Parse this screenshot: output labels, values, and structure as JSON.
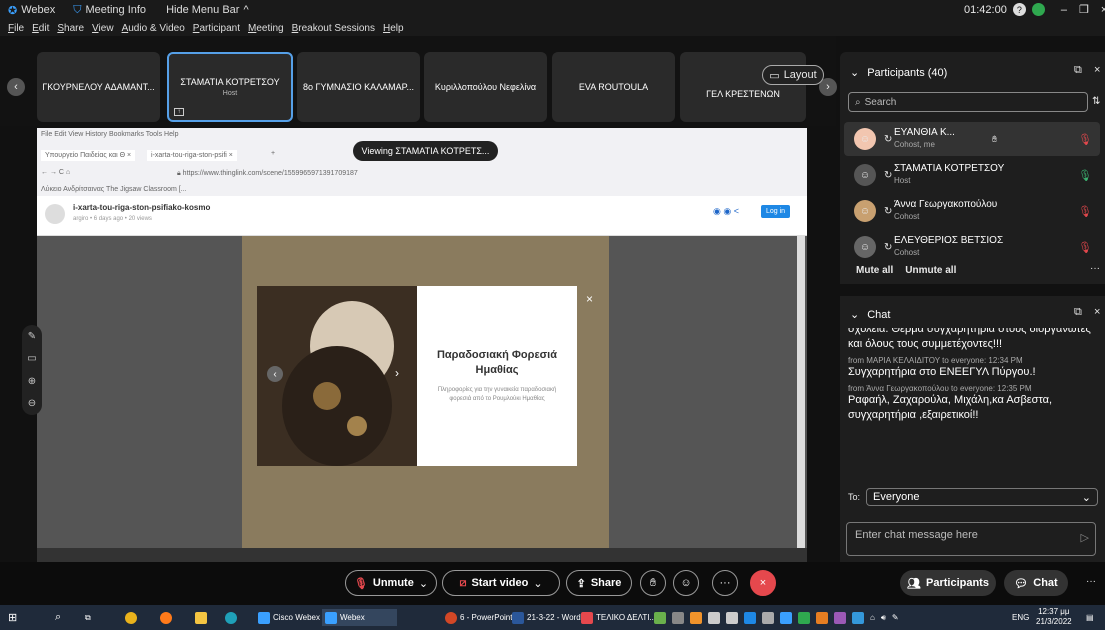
{
  "titlebar": {
    "app": "Webex",
    "meeting_info": "Meeting Info",
    "hide_menu": "Hide Menu Bar",
    "time": "01:42:00"
  },
  "menu": [
    "File",
    "Edit",
    "Share",
    "View",
    "Audio & Video",
    "Participant",
    "Meeting",
    "Breakout Sessions",
    "Help"
  ],
  "filmstrip": {
    "tiles": [
      {
        "name": "ΓΚΟΥΡΝΕΛΟΥ ΑΔΑΜΑΝΤ...",
        "sub": ""
      },
      {
        "name": "ΣΤΑΜΑΤΙΑ ΚΟΤΡΕΤΣΟΥ",
        "sub": "Host"
      },
      {
        "name": "8ο ΓΥΜΝΑΣΙΟ ΚΑΛΑΜΑΡ...",
        "sub": ""
      },
      {
        "name": "Κυριλλοπούλου Νεφελίνα",
        "sub": ""
      },
      {
        "name": "EVA ROUTOULA",
        "sub": ""
      },
      {
        "name": "ΓΕΛ ΚΡΕΣΤΕΝΩΝ",
        "sub": ""
      }
    ],
    "layout_label": "Layout"
  },
  "share": {
    "viewing": "Viewing ΣΤΑΜΑΤΙΑ ΚΟΤΡΕΤΣ...",
    "browser_menu": "File  Edit  View  History  Bookmarks  Tools  Help",
    "tab1": "Υπουργείο Παιδείας και Θ ×",
    "tab2": "i-xarta-tou-riga-ston-psifi ×",
    "url": "https://www.thinglink.com/scene/1559965971391709187",
    "bookmarks": "Λύκειο Ανδρίτσαινας   The Jigsaw Classroom [...",
    "page_title": "i-xarta-tou-riga-ston-psifiako-kosmo",
    "page_author": "argiro  •  6 days ago  •  20 views",
    "login": "Log in",
    "card_title": "Παραδοσιακή Φορεσιά Ημαθίας",
    "card_desc": "Πληροφορίες για την γυναικεία παραδοσιακή φορεσιά από το Ρουμλούκι Ημαθίας"
  },
  "participants": {
    "header": "Participants (40)",
    "search_placeholder": "Search",
    "list": [
      {
        "name": "ΕΥΑΝΘΙΑ Κ...",
        "role": "Cohost, me"
      },
      {
        "name": "ΣΤΑΜΑΤΙΑ ΚΟΤΡΕΤΣΟΥ",
        "role": "Host"
      },
      {
        "name": "Άννα Γεωργακοπούλου",
        "role": "Cohost"
      },
      {
        "name": "ΕΛΕΥΘΕΡΙΟΣ ΒΕΤΣΙΟΣ",
        "role": "Cohost"
      }
    ],
    "mute_all": "Mute all",
    "unmute_all": "Unmute all"
  },
  "chat": {
    "header": "Chat",
    "messages": [
      {
        "meta": "",
        "text": "σχολεία. Θερμά συγχαρητήρια στους διοργανωτές και όλους τους συμμετέχοντες!!!"
      },
      {
        "meta": "from ΜΑΡΙΑ ΚΕΛΑΙΔΙΤΟΥ to everyone:   12:34 PM",
        "text": "Συγχαρητήρια στο ΕΝΕΕΓΥΛ Πύργου.!"
      },
      {
        "meta": "from Άννα Γεωργακοπούλου to everyone:   12:35 PM",
        "text": "Ραφαήλ, Ζαχαρούλα, Μιχάλη,κα Ασβεστα, συγχαρητήρια ,εξαιρετικοί!!"
      }
    ],
    "to_label": "To:",
    "to_value": "Everyone",
    "input_placeholder": "Enter chat message here"
  },
  "controls": {
    "unmute": "Unmute",
    "start_video": "Start video",
    "share": "Share",
    "participants": "Participants",
    "chat": "Chat"
  },
  "taskbar": {
    "items": [
      "Cisco Webex ...",
      "Webex",
      "6 - PowerPoint",
      "21-3-22 - Word",
      "ΤΕΛΙΚΟ ΔΕΛΤΙ..."
    ],
    "lang": "ENG",
    "time": "12:37 μμ",
    "date": "21/3/2022"
  }
}
